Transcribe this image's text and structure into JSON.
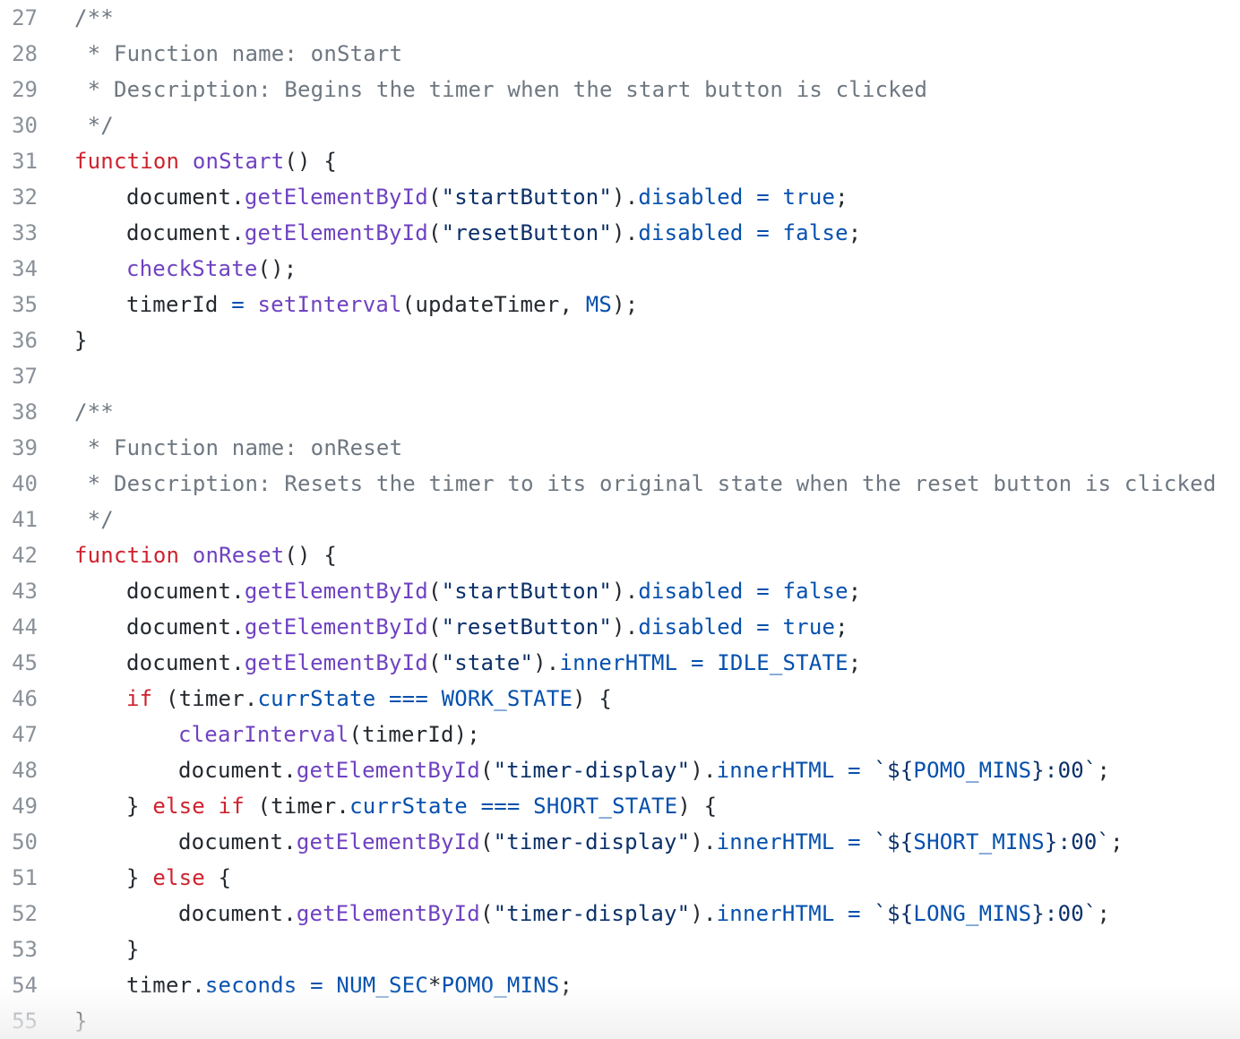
{
  "colors": {
    "keyword": "#cf222e",
    "function": "#6f42c1",
    "string": "#0a3069",
    "property": "#0550ae",
    "comment": "#6e7781",
    "text": "#24292f",
    "line_number": "#8a9199"
  },
  "lines": [
    {
      "number": "27",
      "indent": 0,
      "tokens": [
        {
          "t": "/**",
          "c": "cm"
        }
      ]
    },
    {
      "number": "28",
      "indent": 0,
      "tokens": [
        {
          "t": " * Function name: onStart",
          "c": "cm"
        }
      ]
    },
    {
      "number": "29",
      "indent": 0,
      "tokens": [
        {
          "t": " * Description: Begins the timer when the start button is clicked",
          "c": "cm"
        }
      ]
    },
    {
      "number": "30",
      "indent": 0,
      "tokens": [
        {
          "t": " */",
          "c": "cm"
        }
      ]
    },
    {
      "number": "31",
      "indent": 0,
      "tokens": [
        {
          "t": "function",
          "c": "kw"
        },
        {
          "t": " ",
          "c": "tx"
        },
        {
          "t": "onStart",
          "c": "fn"
        },
        {
          "t": "() {",
          "c": "tx"
        }
      ]
    },
    {
      "number": "32",
      "indent": 1,
      "tokens": [
        {
          "t": "document.",
          "c": "tx"
        },
        {
          "t": "getElementById",
          "c": "fn"
        },
        {
          "t": "(",
          "c": "tx"
        },
        {
          "t": "\"startButton\"",
          "c": "str"
        },
        {
          "t": ").",
          "c": "tx"
        },
        {
          "t": "disabled",
          "c": "prop"
        },
        {
          "t": " ",
          "c": "tx"
        },
        {
          "t": "=",
          "c": "prop"
        },
        {
          "t": " ",
          "c": "tx"
        },
        {
          "t": "true",
          "c": "prop"
        },
        {
          "t": ";",
          "c": "tx"
        }
      ]
    },
    {
      "number": "33",
      "indent": 1,
      "tokens": [
        {
          "t": "document.",
          "c": "tx"
        },
        {
          "t": "getElementById",
          "c": "fn"
        },
        {
          "t": "(",
          "c": "tx"
        },
        {
          "t": "\"resetButton\"",
          "c": "str"
        },
        {
          "t": ").",
          "c": "tx"
        },
        {
          "t": "disabled",
          "c": "prop"
        },
        {
          "t": " ",
          "c": "tx"
        },
        {
          "t": "=",
          "c": "prop"
        },
        {
          "t": " ",
          "c": "tx"
        },
        {
          "t": "false",
          "c": "prop"
        },
        {
          "t": ";",
          "c": "tx"
        }
      ]
    },
    {
      "number": "34",
      "indent": 1,
      "tokens": [
        {
          "t": "checkState",
          "c": "fn"
        },
        {
          "t": "();",
          "c": "tx"
        }
      ]
    },
    {
      "number": "35",
      "indent": 1,
      "tokens": [
        {
          "t": "timerId ",
          "c": "tx"
        },
        {
          "t": "=",
          "c": "prop"
        },
        {
          "t": " ",
          "c": "tx"
        },
        {
          "t": "setInterval",
          "c": "fn"
        },
        {
          "t": "(updateTimer, ",
          "c": "tx"
        },
        {
          "t": "MS",
          "c": "prop"
        },
        {
          "t": ");",
          "c": "tx"
        }
      ]
    },
    {
      "number": "36",
      "indent": 0,
      "tokens": [
        {
          "t": "}",
          "c": "tx"
        }
      ]
    },
    {
      "number": "37",
      "indent": 0,
      "tokens": []
    },
    {
      "number": "38",
      "indent": 0,
      "tokens": [
        {
          "t": "/**",
          "c": "cm"
        }
      ]
    },
    {
      "number": "39",
      "indent": 0,
      "tokens": [
        {
          "t": " * Function name: onReset",
          "c": "cm"
        }
      ]
    },
    {
      "number": "40",
      "indent": 0,
      "tokens": [
        {
          "t": " * Description: Resets the timer to its original state when the reset button is clicked",
          "c": "cm"
        }
      ]
    },
    {
      "number": "41",
      "indent": 0,
      "tokens": [
        {
          "t": " */",
          "c": "cm"
        }
      ]
    },
    {
      "number": "42",
      "indent": 0,
      "tokens": [
        {
          "t": "function",
          "c": "kw"
        },
        {
          "t": " ",
          "c": "tx"
        },
        {
          "t": "onReset",
          "c": "fn"
        },
        {
          "t": "() {",
          "c": "tx"
        }
      ]
    },
    {
      "number": "43",
      "indent": 1,
      "tokens": [
        {
          "t": "document.",
          "c": "tx"
        },
        {
          "t": "getElementById",
          "c": "fn"
        },
        {
          "t": "(",
          "c": "tx"
        },
        {
          "t": "\"startButton\"",
          "c": "str"
        },
        {
          "t": ").",
          "c": "tx"
        },
        {
          "t": "disabled",
          "c": "prop"
        },
        {
          "t": " ",
          "c": "tx"
        },
        {
          "t": "=",
          "c": "prop"
        },
        {
          "t": " ",
          "c": "tx"
        },
        {
          "t": "false",
          "c": "prop"
        },
        {
          "t": ";",
          "c": "tx"
        }
      ]
    },
    {
      "number": "44",
      "indent": 1,
      "tokens": [
        {
          "t": "document.",
          "c": "tx"
        },
        {
          "t": "getElementById",
          "c": "fn"
        },
        {
          "t": "(",
          "c": "tx"
        },
        {
          "t": "\"resetButton\"",
          "c": "str"
        },
        {
          "t": ").",
          "c": "tx"
        },
        {
          "t": "disabled",
          "c": "prop"
        },
        {
          "t": " ",
          "c": "tx"
        },
        {
          "t": "=",
          "c": "prop"
        },
        {
          "t": " ",
          "c": "tx"
        },
        {
          "t": "true",
          "c": "prop"
        },
        {
          "t": ";",
          "c": "tx"
        }
      ]
    },
    {
      "number": "45",
      "indent": 1,
      "tokens": [
        {
          "t": "document.",
          "c": "tx"
        },
        {
          "t": "getElementById",
          "c": "fn"
        },
        {
          "t": "(",
          "c": "tx"
        },
        {
          "t": "\"state\"",
          "c": "str"
        },
        {
          "t": ").",
          "c": "tx"
        },
        {
          "t": "innerHTML",
          "c": "prop"
        },
        {
          "t": " ",
          "c": "tx"
        },
        {
          "t": "=",
          "c": "prop"
        },
        {
          "t": " ",
          "c": "tx"
        },
        {
          "t": "IDLE_STATE",
          "c": "prop"
        },
        {
          "t": ";",
          "c": "tx"
        }
      ]
    },
    {
      "number": "46",
      "indent": 1,
      "tokens": [
        {
          "t": "if",
          "c": "kw"
        },
        {
          "t": " (timer.",
          "c": "tx"
        },
        {
          "t": "currState",
          "c": "prop"
        },
        {
          "t": " ",
          "c": "tx"
        },
        {
          "t": "===",
          "c": "prop"
        },
        {
          "t": " ",
          "c": "tx"
        },
        {
          "t": "WORK_STATE",
          "c": "prop"
        },
        {
          "t": ") {",
          "c": "tx"
        }
      ]
    },
    {
      "number": "47",
      "indent": 2,
      "tokens": [
        {
          "t": "clearInterval",
          "c": "fn"
        },
        {
          "t": "(timerId);",
          "c": "tx"
        }
      ]
    },
    {
      "number": "48",
      "indent": 2,
      "tokens": [
        {
          "t": "document.",
          "c": "tx"
        },
        {
          "t": "getElementById",
          "c": "fn"
        },
        {
          "t": "(",
          "c": "tx"
        },
        {
          "t": "\"timer-display\"",
          "c": "str"
        },
        {
          "t": ").",
          "c": "tx"
        },
        {
          "t": "innerHTML",
          "c": "prop"
        },
        {
          "t": " ",
          "c": "tx"
        },
        {
          "t": "=",
          "c": "prop"
        },
        {
          "t": " ",
          "c": "tx"
        },
        {
          "t": "`${",
          "c": "str"
        },
        {
          "t": "POMO_MINS",
          "c": "prop"
        },
        {
          "t": "}:00`",
          "c": "str"
        },
        {
          "t": ";",
          "c": "tx"
        }
      ]
    },
    {
      "number": "49",
      "indent": 1,
      "tokens": [
        {
          "t": "} ",
          "c": "tx"
        },
        {
          "t": "else if",
          "c": "kw"
        },
        {
          "t": " (timer.",
          "c": "tx"
        },
        {
          "t": "currState",
          "c": "prop"
        },
        {
          "t": " ",
          "c": "tx"
        },
        {
          "t": "===",
          "c": "prop"
        },
        {
          "t": " ",
          "c": "tx"
        },
        {
          "t": "SHORT_STATE",
          "c": "prop"
        },
        {
          "t": ") {",
          "c": "tx"
        }
      ]
    },
    {
      "number": "50",
      "indent": 2,
      "tokens": [
        {
          "t": "document.",
          "c": "tx"
        },
        {
          "t": "getElementById",
          "c": "fn"
        },
        {
          "t": "(",
          "c": "tx"
        },
        {
          "t": "\"timer-display\"",
          "c": "str"
        },
        {
          "t": ").",
          "c": "tx"
        },
        {
          "t": "innerHTML",
          "c": "prop"
        },
        {
          "t": " ",
          "c": "tx"
        },
        {
          "t": "=",
          "c": "prop"
        },
        {
          "t": " ",
          "c": "tx"
        },
        {
          "t": "`${",
          "c": "str"
        },
        {
          "t": "SHORT_MINS",
          "c": "prop"
        },
        {
          "t": "}:00`",
          "c": "str"
        },
        {
          "t": ";",
          "c": "tx"
        }
      ]
    },
    {
      "number": "51",
      "indent": 1,
      "tokens": [
        {
          "t": "} ",
          "c": "tx"
        },
        {
          "t": "else",
          "c": "kw"
        },
        {
          "t": " {",
          "c": "tx"
        }
      ]
    },
    {
      "number": "52",
      "indent": 2,
      "tokens": [
        {
          "t": "document.",
          "c": "tx"
        },
        {
          "t": "getElementById",
          "c": "fn"
        },
        {
          "t": "(",
          "c": "tx"
        },
        {
          "t": "\"timer-display\"",
          "c": "str"
        },
        {
          "t": ").",
          "c": "tx"
        },
        {
          "t": "innerHTML",
          "c": "prop"
        },
        {
          "t": " ",
          "c": "tx"
        },
        {
          "t": "=",
          "c": "prop"
        },
        {
          "t": " ",
          "c": "tx"
        },
        {
          "t": "`${",
          "c": "str"
        },
        {
          "t": "LONG_MINS",
          "c": "prop"
        },
        {
          "t": "}:00`",
          "c": "str"
        },
        {
          "t": ";",
          "c": "tx"
        }
      ]
    },
    {
      "number": "53",
      "indent": 1,
      "tokens": [
        {
          "t": "}",
          "c": "tx"
        }
      ]
    },
    {
      "number": "54",
      "indent": 1,
      "tokens": [
        {
          "t": "timer.",
          "c": "tx"
        },
        {
          "t": "seconds",
          "c": "prop"
        },
        {
          "t": " ",
          "c": "tx"
        },
        {
          "t": "=",
          "c": "prop"
        },
        {
          "t": " ",
          "c": "tx"
        },
        {
          "t": "NUM_SEC",
          "c": "prop"
        },
        {
          "t": "*",
          "c": "tx"
        },
        {
          "t": "POMO_MINS",
          "c": "prop"
        },
        {
          "t": ";",
          "c": "tx"
        }
      ]
    },
    {
      "number": "55",
      "indent": 0,
      "tokens": [
        {
          "t": "}",
          "c": "tx"
        }
      ]
    }
  ]
}
